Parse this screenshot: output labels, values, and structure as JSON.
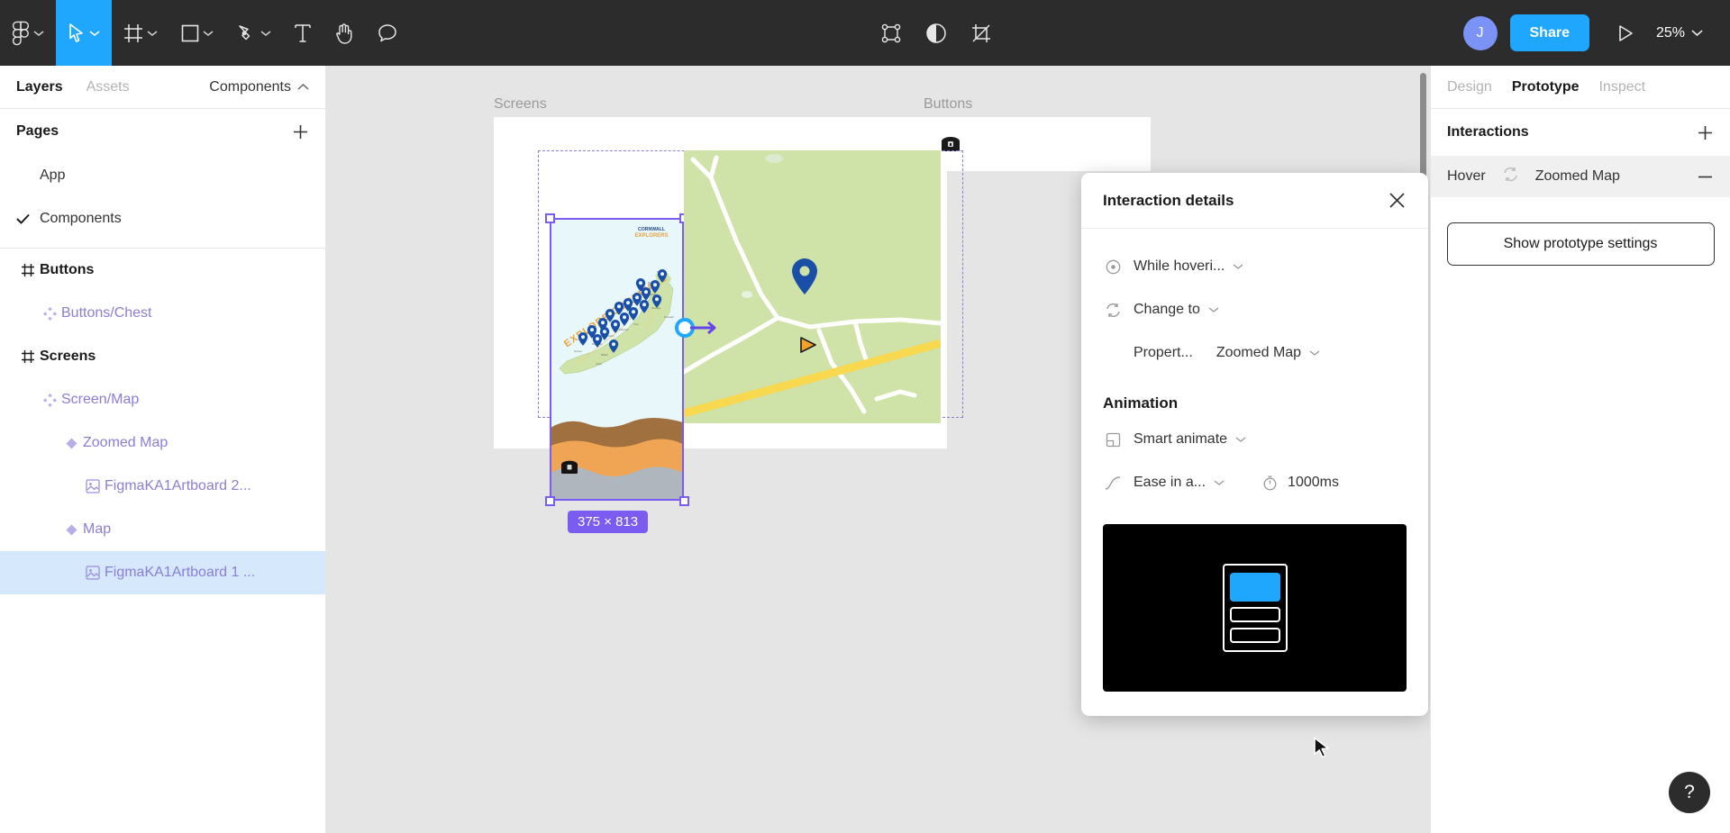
{
  "toolbar": {
    "menu_icon": "figma-logo-icon",
    "tools": [
      {
        "name": "figma-menu",
        "icon": "figma-logo-icon",
        "caret": true,
        "active": false
      },
      {
        "name": "move-tool",
        "icon": "cursor-arrow-icon",
        "caret": true,
        "active": true
      },
      {
        "name": "frame-tool",
        "icon": "frame-icon",
        "caret": true,
        "active": false
      },
      {
        "name": "shape-tool",
        "icon": "square-icon",
        "caret": true,
        "active": false
      },
      {
        "name": "pen-tool",
        "icon": "pen-icon",
        "caret": true,
        "active": false
      },
      {
        "name": "text-tool",
        "icon": "text-icon",
        "caret": false,
        "active": false
      },
      {
        "name": "hand-tool",
        "icon": "hand-icon",
        "caret": false,
        "active": false
      },
      {
        "name": "comment-tool",
        "icon": "comment-bubble-icon",
        "caret": false,
        "active": false
      }
    ],
    "center_tools": [
      {
        "name": "component-tool",
        "icon": "component-icon"
      },
      {
        "name": "mask-tool",
        "icon": "contrast-circle-icon"
      },
      {
        "name": "crop-tool",
        "icon": "crop-icon"
      }
    ],
    "avatar_initial": "J",
    "share_label": "Share",
    "present_icon": "play-triangle-icon",
    "zoom_level": "25%"
  },
  "left_panel": {
    "tabs": [
      {
        "label": "Layers",
        "active": true
      },
      {
        "label": "Assets",
        "active": false
      }
    ],
    "components_label": "Components",
    "pages_label": "Pages",
    "pages": [
      {
        "label": "App",
        "checked": false
      },
      {
        "label": "Components",
        "checked": true
      }
    ],
    "layers": [
      {
        "label": "Buttons",
        "icon": "frame-hash-icon",
        "indent": 0,
        "type": "group",
        "selected": false
      },
      {
        "label": "Buttons/Chest",
        "icon": "component-set-icon",
        "indent": 1,
        "type": "component",
        "selected": false
      },
      {
        "label": "Screens",
        "icon": "frame-hash-icon",
        "indent": 0,
        "type": "group",
        "selected": false
      },
      {
        "label": "Screen/Map",
        "icon": "component-set-icon",
        "indent": 1,
        "type": "component",
        "selected": false
      },
      {
        "label": "Zoomed Map",
        "icon": "variant-diamond-icon",
        "indent": 2,
        "type": "variant",
        "selected": false
      },
      {
        "label": "FigmaKA1Artboard 2...",
        "icon": "image-icon",
        "indent": 3,
        "type": "image",
        "selected": false
      },
      {
        "label": "Map",
        "icon": "variant-diamond-icon",
        "indent": 2,
        "type": "variant",
        "selected": false
      },
      {
        "label": "FigmaKA1Artboard 1 ...",
        "icon": "image-icon",
        "indent": 3,
        "type": "image",
        "selected": true
      }
    ]
  },
  "canvas": {
    "frames": [
      {
        "label": "Screens"
      },
      {
        "label": "Buttons"
      }
    ],
    "selection_size": "375 × 813",
    "map_title": "EXPLORE CORNWALL",
    "logo_line1": "CORNWALL",
    "logo_line2": "EXPLORERS",
    "place_labels": [
      "Tintagel",
      "Polzeath",
      "Padstow",
      "Wadebridge",
      "Bodmin",
      "Newquay",
      "St Austell",
      "Looe",
      "Truro",
      "Falmouth",
      "Helston",
      "Penzance",
      "St Ives",
      "Sennen",
      "Mullion",
      "Lizard"
    ],
    "chest_icon": "treasure-chest-icon"
  },
  "dialog": {
    "title": "Interaction details",
    "close_icon": "close-x-icon",
    "trigger": {
      "icon": "trigger-target-icon",
      "label": "While hoveri..."
    },
    "action": {
      "icon": "change-to-icon",
      "label": "Change to"
    },
    "property": {
      "label": "Propert...",
      "value": "Zoomed Map"
    },
    "animation_label": "Animation",
    "animation_type": {
      "icon": "smart-animate-icon",
      "label": "Smart animate"
    },
    "easing": {
      "icon": "easing-curve-icon",
      "label": "Ease in a..."
    },
    "duration": {
      "icon": "stopwatch-icon",
      "value": "1000ms"
    }
  },
  "right_panel": {
    "tabs": [
      {
        "label": "Design",
        "active": false
      },
      {
        "label": "Prototype",
        "active": true
      },
      {
        "label": "Inspect",
        "active": false
      }
    ],
    "interactions_label": "Interactions",
    "add_icon": "plus-icon",
    "interaction": {
      "trigger": "Hover",
      "arrow_icon": "change-to-icon",
      "destination": "Zoomed Map",
      "remove_icon": "minus-icon"
    },
    "show_settings_label": "Show prototype settings"
  },
  "help": {
    "label": "?"
  }
}
